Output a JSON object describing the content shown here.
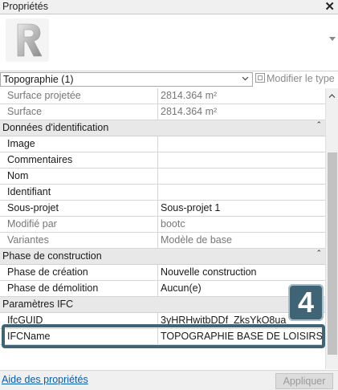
{
  "window": {
    "title": "Propriétés",
    "close_glyph": "✕"
  },
  "preview": {
    "logo_icon": "revit-r-logo-icon"
  },
  "type_selector": {
    "value": "Topographie (1)",
    "edit_type_label": "Modifier le type"
  },
  "rows": [
    {
      "kind": "prop",
      "key": "Surface projetée",
      "value": "2814.364 m²",
      "readonly": true
    },
    {
      "kind": "prop",
      "key": "Surface",
      "value": "2814.364 m²",
      "readonly": true
    },
    {
      "kind": "group",
      "key": "Données d'identification"
    },
    {
      "kind": "prop",
      "key": "Image",
      "value": ""
    },
    {
      "kind": "prop",
      "key": "Commentaires",
      "value": ""
    },
    {
      "kind": "prop",
      "key": "Nom",
      "value": ""
    },
    {
      "kind": "prop",
      "key": "Identifiant",
      "value": ""
    },
    {
      "kind": "prop",
      "key": "Sous-projet",
      "value": "Sous-projet 1"
    },
    {
      "kind": "prop",
      "key": "Modifié par",
      "value": "bootc",
      "readonly": true
    },
    {
      "kind": "prop",
      "key": "Variantes",
      "value": "Modèle de base",
      "readonly": true
    },
    {
      "kind": "group",
      "key": "Phase de construction"
    },
    {
      "kind": "prop",
      "key": "Phase de création",
      "value": "Nouvelle construction"
    },
    {
      "kind": "prop",
      "key": "Phase de démolition",
      "value": "Aucun(e)"
    },
    {
      "kind": "group",
      "key": "Paramètres IFC"
    },
    {
      "kind": "prop",
      "key": "IfcGUID",
      "value": "3yHRHwitbDDf_ZksYkO8ua"
    },
    {
      "kind": "prop",
      "key": "IFCName",
      "value": "TOPOGRAPHIE BASE DE LOISIRS"
    }
  ],
  "callout": {
    "number": "4",
    "color": "#3e6475"
  },
  "footer": {
    "help_link": "Aide des propriétés",
    "apply_label": "Appliquer"
  }
}
